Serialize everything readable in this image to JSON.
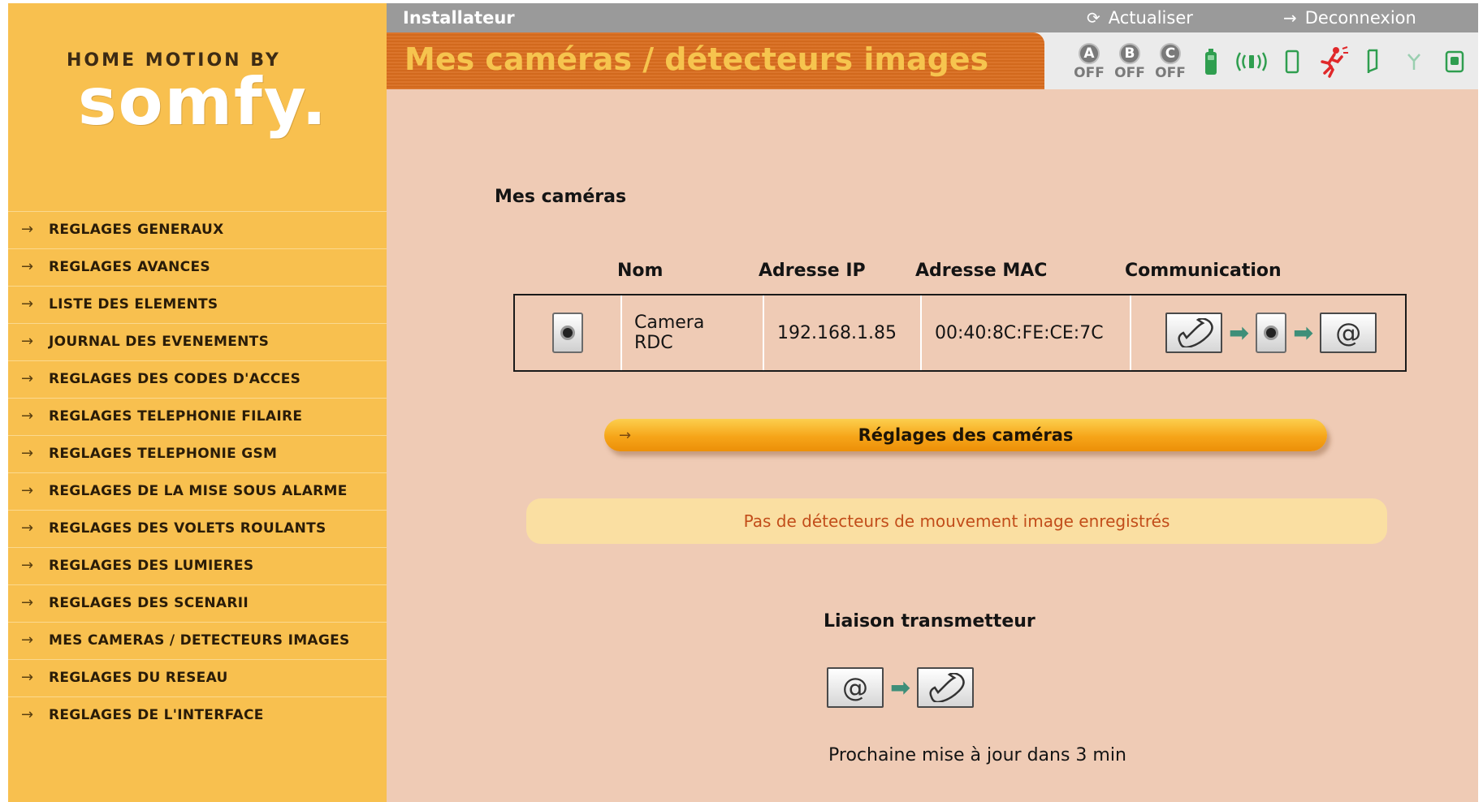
{
  "brand": {
    "by_line": "HOME MOTION BY",
    "logo_text": "somfy."
  },
  "sidebar": {
    "items": [
      {
        "label": "REGLAGES GENERAUX"
      },
      {
        "label": "REGLAGES AVANCES"
      },
      {
        "label": "LISTE DES ELEMENTS"
      },
      {
        "label": "JOURNAL DES EVENEMENTS"
      },
      {
        "label": "REGLAGES DES CODES D'ACCES"
      },
      {
        "label": "REGLAGES TELEPHONIE FILAIRE"
      },
      {
        "label": "REGLAGES TELEPHONIE GSM"
      },
      {
        "label": "REGLAGES DE LA MISE SOUS ALARME"
      },
      {
        "label": "REGLAGES DES VOLETS ROULANTS"
      },
      {
        "label": "REGLAGES DES LUMIERES"
      },
      {
        "label": "REGLAGES DES SCENARII"
      },
      {
        "label": "MES CAMERAS / DETECTEURS IMAGES"
      },
      {
        "label": "REGLAGES DU RESEAU"
      },
      {
        "label": "REGLAGES DE L'INTERFACE"
      }
    ],
    "arrow_glyph": "→"
  },
  "topbar": {
    "role": "Installateur",
    "refresh_label": "Actualiser",
    "logout_label": "Deconnexion"
  },
  "page": {
    "title": "Mes caméras / détecteurs images"
  },
  "status": {
    "zones": [
      {
        "letter": "A",
        "state": "OFF"
      },
      {
        "letter": "B",
        "state": "OFF"
      },
      {
        "letter": "C",
        "state": "OFF"
      }
    ],
    "icons": [
      "battery-icon",
      "radio-signal-icon",
      "door-sensor-icon",
      "intrusion-alert-icon",
      "tamper-icon",
      "antenna-icon",
      "keypad-icon"
    ],
    "colors": {
      "active_green": "#2f9e4f",
      "alert_red": "#e0282a",
      "inactive_gray": "#7a7a7a"
    }
  },
  "cameras": {
    "heading": "Mes caméras",
    "columns": {
      "name": "Nom",
      "ip": "Adresse IP",
      "mac": "Adresse MAC",
      "communication": "Communication"
    },
    "rows": [
      {
        "name_line1": "Camera",
        "name_line2": "RDC",
        "ip": "192.168.1.85",
        "mac": "00:40:8C:FE:CE:7C",
        "comm_at": "@"
      }
    ],
    "settings_button": "Réglages des caméras"
  },
  "detectors": {
    "empty_message": "Pas de détecteurs de mouvement image enregistrés"
  },
  "liaison": {
    "heading": "Liaison transmetteur",
    "at_symbol": "@",
    "next_update": "Prochaine mise à jour dans 3 min"
  }
}
